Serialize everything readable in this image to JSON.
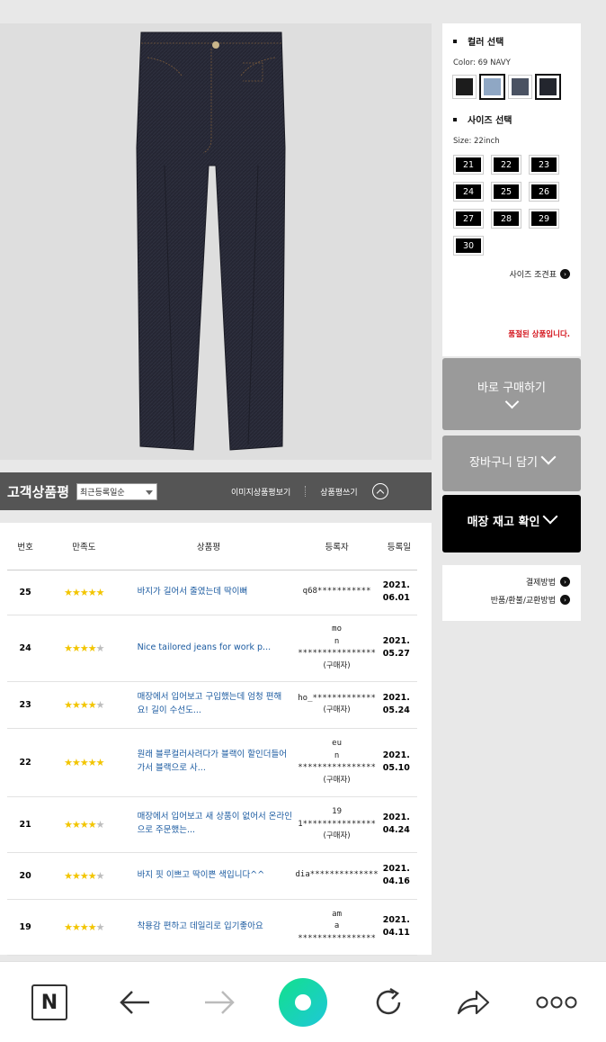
{
  "options": {
    "color_heading": "컬러 선택",
    "color_selected": "Color: 69 NAVY",
    "swatches": [
      {
        "name": "black",
        "color": "#1c1c1c"
      },
      {
        "name": "light-blue",
        "color": "#8fa7c4"
      },
      {
        "name": "blue-gray",
        "color": "#4a5262"
      },
      {
        "name": "navy",
        "color": "#23262e"
      }
    ],
    "size_heading": "사이즈 선택",
    "size_selected": "Size: 22inch",
    "sizes": [
      "21",
      "22",
      "23",
      "24",
      "25",
      "26",
      "27",
      "28",
      "29",
      "30"
    ],
    "size_chart": "사이즈 조견표",
    "soldout": "품절된 상품입니다."
  },
  "buttons": {
    "buy": "바로 구매하기",
    "cart": "장바구니 담기",
    "stock": "매장 재고 확인"
  },
  "payment": {
    "method": "결제방법",
    "return": "반품/환불/교환방법"
  },
  "review_bar": {
    "title": "고객상품평",
    "sort": "최근등록일순",
    "photo_reviews": "이미지상품평보기",
    "write": "상품평쓰기"
  },
  "table": {
    "headers": [
      "번호",
      "만족도",
      "상품평",
      "등록자",
      "등록일"
    ],
    "rows": [
      {
        "num": "25",
        "stars": 5,
        "title": "바지가 길어서 줄였는데 딱이뻐",
        "author": "q68***********",
        "buyer": "",
        "date1": "2021.",
        "date2": "06.01"
      },
      {
        "num": "24",
        "stars": 4,
        "title": "Nice tailored jeans for work p...",
        "author": "mo\nn\n****************",
        "buyer": "(구매자)",
        "date1": "2021.",
        "date2": "05.27"
      },
      {
        "num": "23",
        "stars": 4,
        "title": "매장에서 입어보고 구입했는데 엄청 편해요! 길이 수선도...",
        "author": "ho_*************",
        "buyer": "(구매자)",
        "date1": "2021.",
        "date2": "05.24"
      },
      {
        "num": "22",
        "stars": 5,
        "title": "원래 블루컬러사려다가 블랙이 할인더들어가서 블랙으로 사...",
        "author": "eu\nn\n****************",
        "buyer": "(구매자)",
        "date1": "2021.",
        "date2": "05.10"
      },
      {
        "num": "21",
        "stars": 4,
        "title": "매장에서 입어보고 새 상품이 없어서 온라인으로 주문했는...",
        "author": "19\n1***************",
        "buyer": "(구매자)",
        "date1": "2021.",
        "date2": "04.24"
      },
      {
        "num": "20",
        "stars": 4,
        "title": "바지 핏 이쁘고 딱이쁜 색입니다^^",
        "author": "dia**************",
        "buyer": "",
        "date1": "2021.",
        "date2": "04.16"
      },
      {
        "num": "19",
        "stars": 4,
        "title": "착용감 편하고 데일리로 입기좋아요",
        "author": "am\na\n****************",
        "buyer": "",
        "date1": "2021.",
        "date2": "04.11"
      }
    ]
  },
  "nav": {
    "home_letter": "N",
    "accent": "#19d8a8"
  }
}
